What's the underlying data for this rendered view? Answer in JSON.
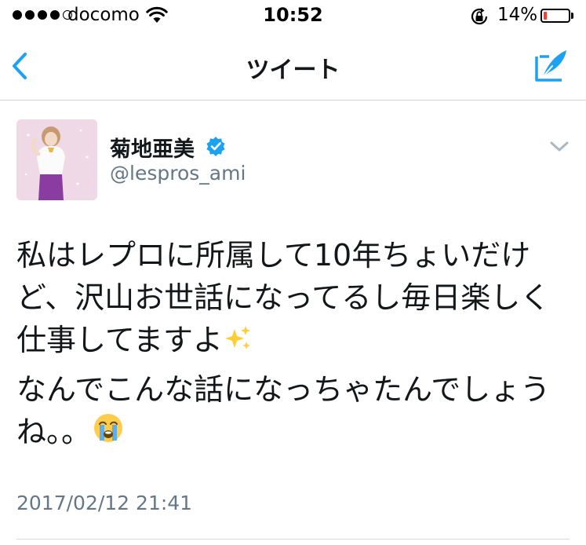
{
  "status_bar": {
    "carrier": "docomo",
    "time": "10:52",
    "battery_percent": "14%",
    "battery_level": 0.14,
    "signal_bars_filled": 4,
    "signal_bars_total": 5
  },
  "nav": {
    "title": "ツイート",
    "back_icon": "chevron-left-icon",
    "compose_icon": "compose-quill-icon"
  },
  "tweet": {
    "author_name": "菊地亜美",
    "author_handle": "@lespros_ami",
    "verified": true,
    "paragraphs": [
      "私はレプロに所属して10年ちょいだけど、沢山お世話になってるし毎日楽しく仕事してますよ",
      "なんでこんな話になっちゃたんでしょうね。。"
    ],
    "emoji": [
      "sparkles-emoji",
      "crying-face-emoji"
    ],
    "timestamp": "2017/02/12 21:41"
  },
  "colors": {
    "accent": "#1da1f2",
    "text": "#14171a",
    "secondary_text": "#657786",
    "battery_low": "#ff3b30"
  }
}
